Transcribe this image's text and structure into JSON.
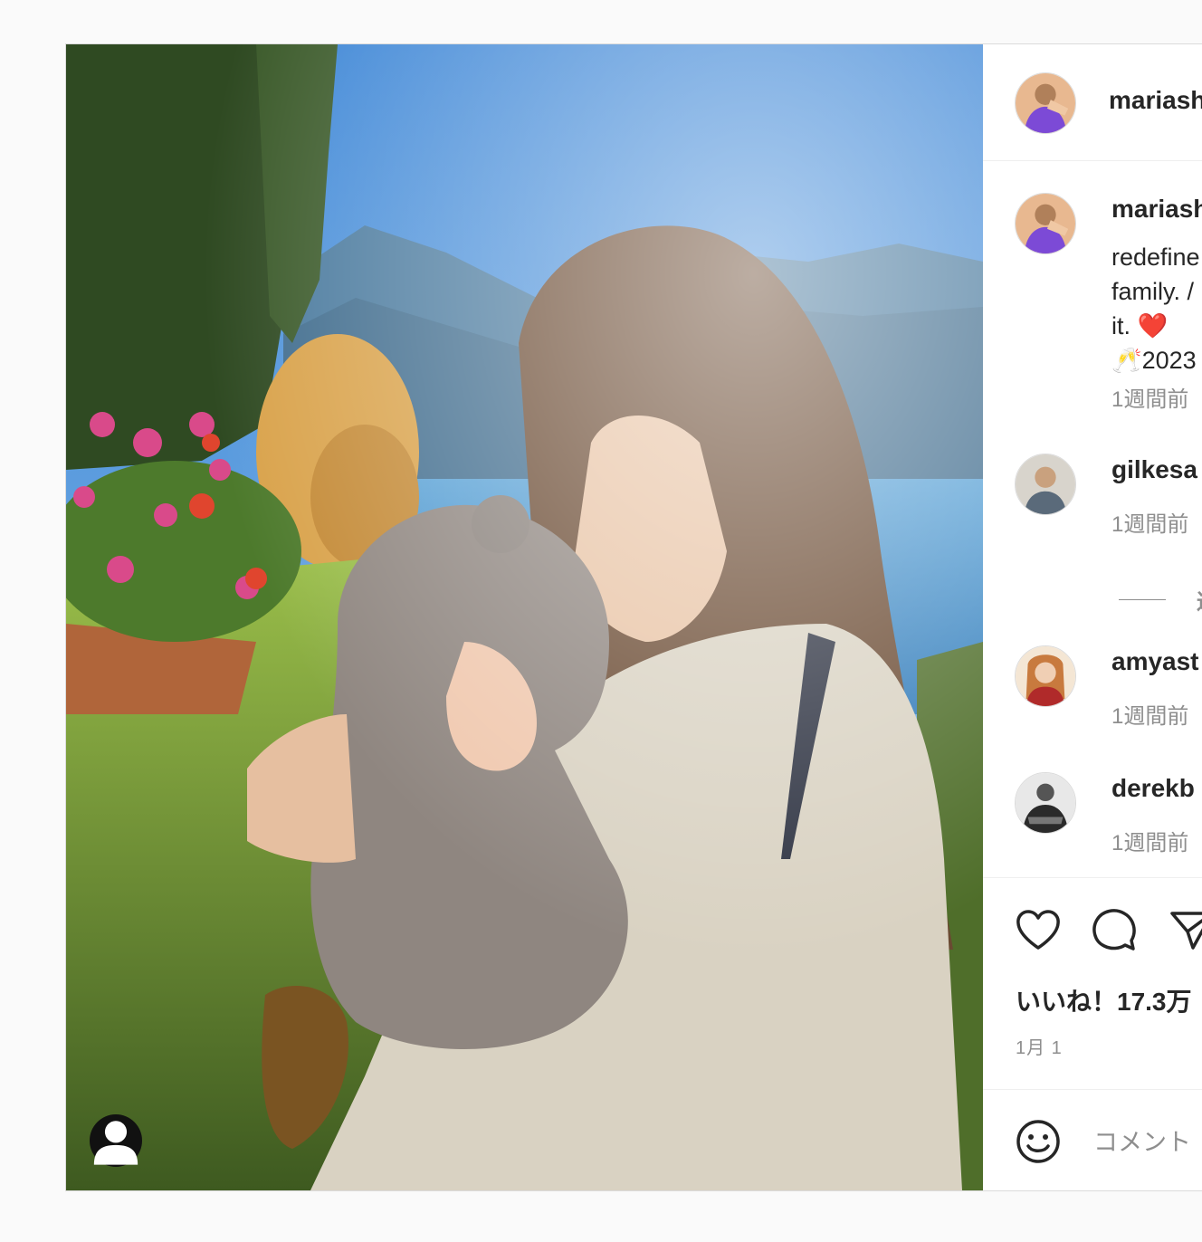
{
  "post": {
    "author": {
      "username": "mariash",
      "avatar_icon": "profile-photo"
    },
    "caption": {
      "username": "mariash",
      "lines": [
        "redefine",
        "family. /",
        "it. ❤️",
        "🥂2023"
      ],
      "timestamp": "1週間前"
    },
    "comments": [
      {
        "username": "gilkesa",
        "timestamp": "1週間前",
        "avatar_icon": "profile-photo"
      },
      {
        "username": "amyast",
        "timestamp": "1週間前",
        "avatar_icon": "profile-photo"
      },
      {
        "username": "derekb",
        "timestamp": "1週間前",
        "avatar_icon": "profile-photo"
      }
    ],
    "more_replies_label": "返",
    "actions": {
      "like_icon": "heart-icon",
      "comment_icon": "comment-bubble-icon",
      "share_icon": "paper-plane-icon"
    },
    "likes_label": "いいね！17.3万",
    "date": "1月 1",
    "comment_placeholder": "コメント",
    "user_tag_icon": "user-tag-icon"
  },
  "colors": {
    "text": "#262626",
    "secondary": "#8e8e8e",
    "divider": "#efefef"
  }
}
